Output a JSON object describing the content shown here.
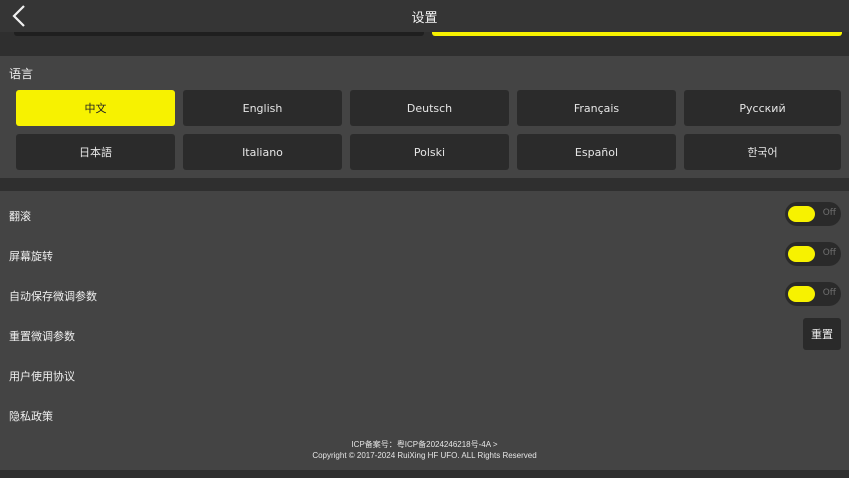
{
  "header": {
    "title": "设置"
  },
  "language": {
    "label": "语言",
    "options": [
      "中文",
      "English",
      "Deutsch",
      "Français",
      "Русский",
      "日本語",
      "Italiano",
      "Polski",
      "Español",
      "한국어"
    ],
    "selected": "中文"
  },
  "settings": {
    "scroll_label": "翻滚",
    "scroll_state": "Off",
    "rotate_label": "屏幕旋转",
    "rotate_state": "Off",
    "autosave_label": "自动保存微调参数",
    "autosave_state": "Off",
    "reset_label": "重置微调参数",
    "reset_button": "重置",
    "agreement_label": "用户使用协议",
    "privacy_label": "隐私政策"
  },
  "footer": {
    "icp": "ICP备案号：粤ICP备2024246218号-4A >",
    "copyright": "Copyright © 2017-2024 RuiXing HF UFO. ALL Rights Reserved"
  },
  "colors": {
    "accent": "#f7f200",
    "panel": "#444444",
    "background": "#2f2f2f",
    "button": "#2b2b2b"
  },
  "icons": {
    "back": "chevron-left-icon"
  }
}
